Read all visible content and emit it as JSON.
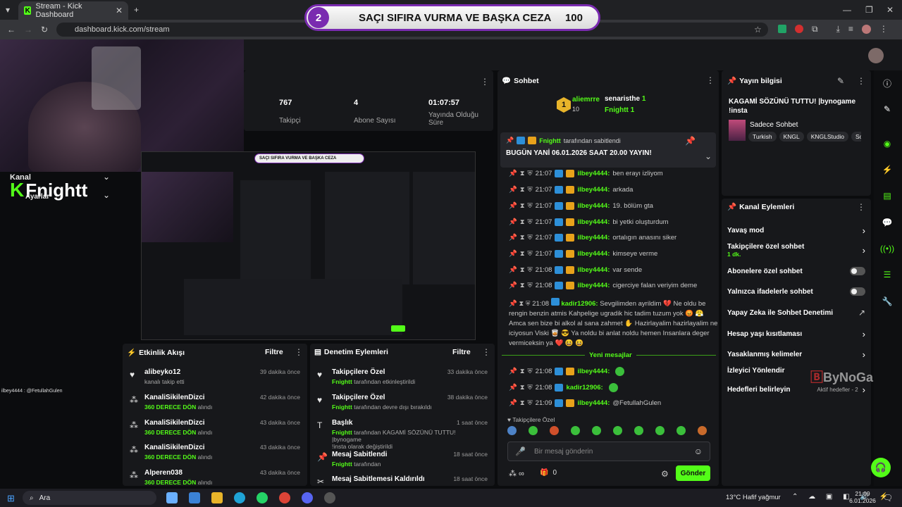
{
  "browser": {
    "tab_title": "Stream - Kick Dashboard",
    "url": "dashboard.kick.com/stream"
  },
  "overlay": {
    "number": "2",
    "text": "SAÇI SIFIRA VURMA VE BAŞKA CEZA",
    "score": "100"
  },
  "channel": {
    "kanal_label": "Kanal",
    "name": "Fnightt",
    "ayarlar_label": "Ayarlar"
  },
  "stats": [
    {
      "value": "767",
      "label": "Takipçi"
    },
    {
      "value": "4",
      "label": "Abone Sayısı"
    },
    {
      "value": "01:07:57",
      "label": "Yayında Olduğu Süre"
    }
  ],
  "chat": {
    "title": "Sohbet",
    "leaders": [
      {
        "name": "aliemrre",
        "count": "10"
      },
      {
        "name": "senaristhe",
        "count": "1"
      },
      {
        "name": "Fnightt",
        "count": "1"
      }
    ],
    "pinned_by": "Fnightt",
    "pinned_by_suffix": "tarafından sabitlendi",
    "pinned_text": "BUGÜN YANİ 06.01.2026 SAAT 20.00 YAYIN!",
    "messages": [
      {
        "time": "21:07",
        "user": "ilbey4444:",
        "text": "ben erayı izliyom"
      },
      {
        "time": "21:07",
        "user": "ilbey4444:",
        "text": "arkada"
      },
      {
        "time": "21:07",
        "user": "ilbey4444:",
        "text": "19. bölüm gta"
      },
      {
        "time": "21:07",
        "user": "ilbey4444:",
        "text": "bi yetki oluşturdum"
      },
      {
        "time": "21:07",
        "user": "ilbey4444:",
        "text": "ortalıgın anasını siker"
      },
      {
        "time": "21:07",
        "user": "ilbey4444:",
        "text": "kimseye verme"
      },
      {
        "time": "21:08",
        "user": "ilbey4444:",
        "text": "var sende"
      },
      {
        "time": "21:08",
        "user": "ilbey4444:",
        "text": "cigerciye falan veriyim deme"
      }
    ],
    "long_msg": {
      "time": "21:08",
      "user": "kadir12906:",
      "line1": "Sevgilimden ayrildim 💔 Ne oldu be",
      "line2": "rengin benzin atmis Kahpelige ugradik hic tadim tuzum yok 😡 😤",
      "line3": "Amca sen bize bi alkol al sana zahmet ✋ Hazirlayalim hazirlayalim ne",
      "line4": "iciyosun Viski 🥃 😎 Ya noldu bi anlat noldu hemen Insanlara deger",
      "line5": "vermiceksin ya ❤️ 😆 😆"
    },
    "new_messages_label": "Yeni mesajlar",
    "new_messages": [
      {
        "time": "21:08",
        "user": "ilbey4444:",
        "text": ""
      },
      {
        "time": "21:08",
        "user": "kadir12906:",
        "text": ""
      },
      {
        "time": "21:09",
        "user": "ilbey4444:",
        "text": "@FetullahGulen"
      }
    ],
    "followers_only": "Takipçilere Özel",
    "input_placeholder": "Bir mesaj gönderin",
    "points": "0",
    "send_label": "Gönder"
  },
  "stream_info": {
    "title": "Yayın bilgisi",
    "stream_title": "KAGAMİ SÖZÜNÜ TUTTU! |bynogame !insta",
    "category": "Sadece Sohbet",
    "tags": [
      "Turkish",
      "KNGL",
      "KNGLStudio",
      "So"
    ]
  },
  "channel_actions": {
    "title": "Kanal Eylemleri",
    "items": [
      {
        "label": "Yavaş mod"
      },
      {
        "label": "Takipçilere özel sohbet",
        "sub": "1 dk."
      },
      {
        "label": "Abonelere özel sohbet"
      },
      {
        "label": "Yalnızca ifadelerle sohbet"
      },
      {
        "label": "Yapay Zeka ile Sohbet Denetimi"
      },
      {
        "label": "Hesap yaşı kısıtlaması"
      },
      {
        "label": "Yasaklanmış kelimeler"
      },
      {
        "label": "İzleyici Yönlendir"
      },
      {
        "label": "Hedefleri belirleyin",
        "sub": "Aktif hedefler - 2"
      }
    ]
  },
  "activity": {
    "title": "Etkinlik Akışı",
    "filter": "Filtre",
    "items": [
      {
        "user": "alibeyko12",
        "desc": "kanalı takip etti",
        "desc_green": "",
        "time": "39 dakika önce"
      },
      {
        "user": "KanaliSikilenDizci",
        "desc": "alındı",
        "desc_green": "360 DERECE DÖN",
        "time": "42 dakika önce"
      },
      {
        "user": "KanaliSikilenDizci",
        "desc": "alındı",
        "desc_green": "360 DERECE DÖN",
        "time": "43 dakika önce"
      },
      {
        "user": "KanaliSikilenDizci",
        "desc": "alındı",
        "desc_green": "360 DERECE DÖN",
        "time": "43 dakika önce"
      },
      {
        "user": "Alperen038",
        "desc": "alındı",
        "desc_green": "360 DERECE DÖN",
        "time": "43 dakika önce"
      }
    ]
  },
  "moderation": {
    "title": "Denetim Eylemleri",
    "filter": "Filtre",
    "items": [
      {
        "title": "Takipçilere Özel",
        "who": "Fnightt",
        "desc": "tarafından etkinleştirildi",
        "time": "33 dakika önce"
      },
      {
        "title": "Takipçilere Özel",
        "who": "Fnightt",
        "desc": "tarafından devre dışı bırakıldı",
        "time": "38 dakika önce"
      },
      {
        "title": "Başlık",
        "who": "Fnightt",
        "desc": "tarafından KAGAMİ SÖZÜNÜ TUTTU! |bynogame",
        "desc2": "!insta olarak değiştirildi",
        "time": "1 saat önce"
      },
      {
        "title": "Mesaj Sabitlendi",
        "who": "Fnightt",
        "desc": "tarafından",
        "time": "18 saat önce"
      },
      {
        "title": "Mesaj Sabitlemesi Kaldırıldı",
        "who": "",
        "desc": "",
        "time": "18 saat önce"
      }
    ]
  },
  "side_chat_overlay": "ilbey4444 : @FetullahGulen",
  "watermark": "ByNoGame",
  "taskbar": {
    "search": "Ara",
    "weather": "13°C  Hafif yağmur",
    "time": "21:09",
    "date": "6.01.2026"
  }
}
